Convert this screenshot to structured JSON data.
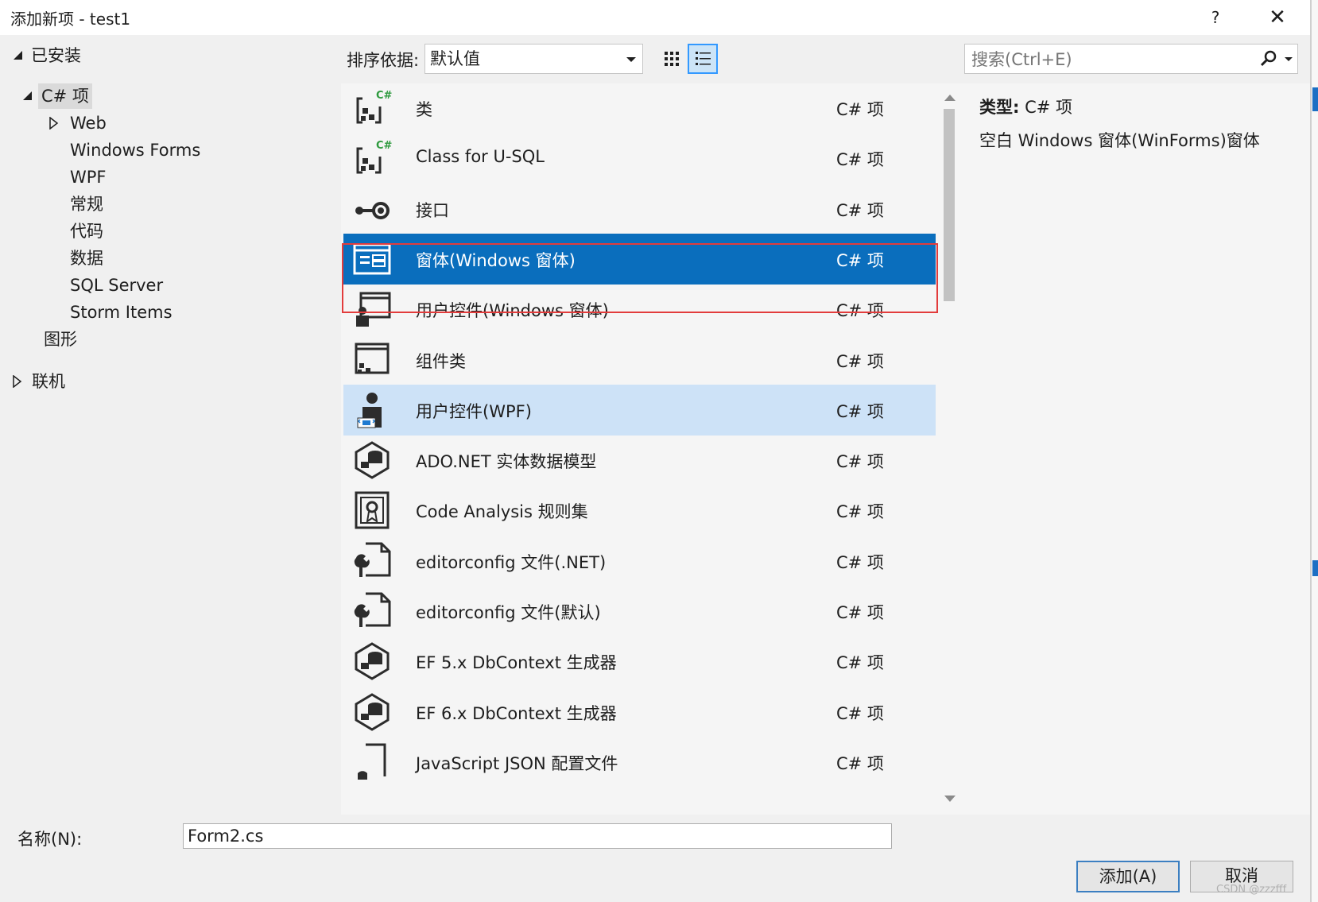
{
  "dialog": {
    "title": "添加新项 - test1",
    "help_label": "?",
    "close_label": "✕"
  },
  "tree": {
    "installed": "已安装",
    "csharp": "C# 项",
    "web": "Web",
    "winforms": "Windows Forms",
    "wpf": "WPF",
    "general": "常规",
    "code": "代码",
    "data": "数据",
    "sql": "SQL Server",
    "storm": "Storm Items",
    "graphics": "图形",
    "online": "联机"
  },
  "toolbar": {
    "sort_label": "排序依据:",
    "sort_value": "默认值",
    "search_placeholder": "搜索(Ctrl+E)"
  },
  "items": [
    {
      "name": "类",
      "category": "C# 项",
      "icon": "class-icon"
    },
    {
      "name": "Class for U-SQL",
      "category": "C# 项",
      "icon": "class-icon"
    },
    {
      "name": "接口",
      "category": "C# 项",
      "icon": "interface-icon"
    },
    {
      "name": "窗体(Windows 窗体)",
      "category": "C# 项",
      "icon": "form-icon"
    },
    {
      "name": "用户控件(Windows 窗体)",
      "category": "C# 项",
      "icon": "user-control-icon"
    },
    {
      "name": "组件类",
      "category": "C# 项",
      "icon": "component-icon"
    },
    {
      "name": "用户控件(WPF)",
      "category": "C# 项",
      "icon": "wpf-user-control-icon"
    },
    {
      "name": "ADO.NET 实体数据模型",
      "category": "C# 项",
      "icon": "entity-model-icon"
    },
    {
      "name": "Code Analysis 规则集",
      "category": "C# 项",
      "icon": "ruleset-icon"
    },
    {
      "name": "editorconfig 文件(.NET)",
      "category": "C# 项",
      "icon": "config-file-icon"
    },
    {
      "name": "editorconfig 文件(默认)",
      "category": "C# 项",
      "icon": "config-file-icon"
    },
    {
      "name": "EF 5.x DbContext 生成器",
      "category": "C# 项",
      "icon": "entity-model-icon"
    },
    {
      "name": "EF 6.x DbContext 生成器",
      "category": "C# 项",
      "icon": "entity-model-icon"
    },
    {
      "name": "JavaScript JSON 配置文件",
      "category": "C# 项",
      "icon": "json-file-icon"
    }
  ],
  "details": {
    "type_label": "类型:",
    "type_value": "C# 项",
    "description": "空白 Windows 窗体(WinForms)窗体"
  },
  "footer": {
    "name_label": "名称(N):",
    "name_value": "Form2.cs",
    "add_button": "添加(A)",
    "cancel_button": "取消"
  },
  "watermark": "CSDN @zzzfff",
  "colors": {
    "selected_row": "#0a6ebd",
    "hover_row": "#cde2f7",
    "highlight_outline": "#e23c3c",
    "accent": "#3399ff"
  }
}
